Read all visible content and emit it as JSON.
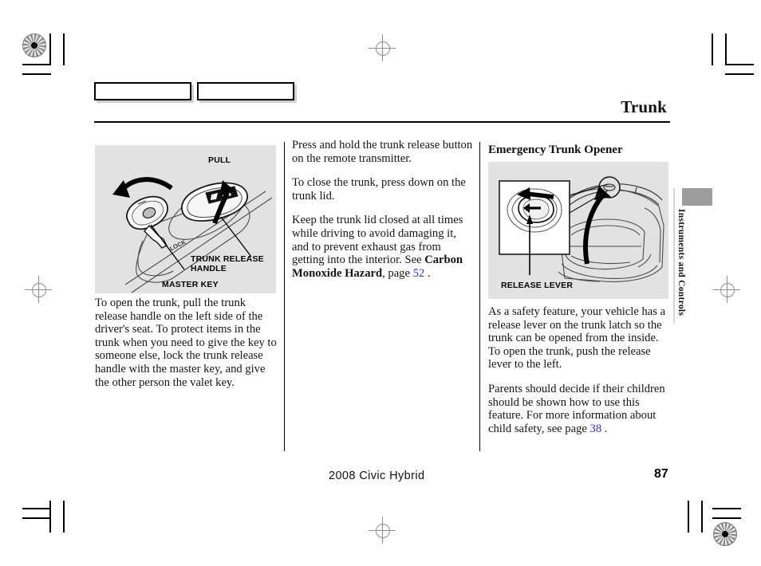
{
  "header": {
    "title": "Trunk",
    "tab_box_1_label": "",
    "tab_box_2_label": ""
  },
  "side_tab": {
    "label": "Instruments and Controls"
  },
  "columns": {
    "left": {
      "figure": {
        "name": "trunk-release-handle-illustration",
        "callouts": [
          {
            "id": "pull",
            "text": "PULL"
          },
          {
            "id": "trunk-release-handle-line1",
            "text": "TRUNK RELEASE"
          },
          {
            "id": "trunk-release-handle-line2",
            "text": "HANDLE"
          },
          {
            "id": "master-key",
            "text": "MASTER KEY"
          }
        ]
      },
      "paragraphs": [
        "To open the trunk, pull the trunk release handle on the left side of the driver's seat. To protect items in the trunk when you need to give the key to someone else, lock the trunk release handle with the master key, and give the other person the valet key."
      ]
    },
    "middle": {
      "paragraph_1": "Press and hold the trunk release button on the remote transmitter.",
      "paragraph_2": "To close the trunk, press down on the trunk lid.",
      "paragraph_3_part_1": "Keep the trunk lid closed at all times while driving to avoid damaging it, and to prevent exhaust gas from getting into the interior. See ",
      "paragraph_3_bold": "Carbon Monoxide Hazard",
      "paragraph_3_part_2": ", page ",
      "paragraph_3_page_ref": "52",
      "paragraph_3_part_3": " ."
    },
    "right": {
      "heading": "Emergency Trunk Opener",
      "figure": {
        "name": "emergency-trunk-opener-illustration",
        "callouts": [
          {
            "id": "release-lever",
            "text": "RELEASE LEVER"
          }
        ]
      },
      "paragraph_1": "As a safety feature, your vehicle has a release lever on the trunk latch so the trunk can be opened from the inside. To open the trunk, push the release lever to the left.",
      "paragraph_2_part_1": "Parents should decide if their children should be shown how to use this feature. For more information about child safety, see page ",
      "paragraph_2_page_ref": "38",
      "paragraph_2_part_2": " ."
    }
  },
  "footer": {
    "model": "2008  Civic  Hybrid",
    "page_number": "87"
  },
  "colors": {
    "illustration_background": "#e2e2e2",
    "page_reference_link": "#2f2fcc",
    "thumb_tab_block": "#9d9d9d",
    "rule": "#000000"
  }
}
